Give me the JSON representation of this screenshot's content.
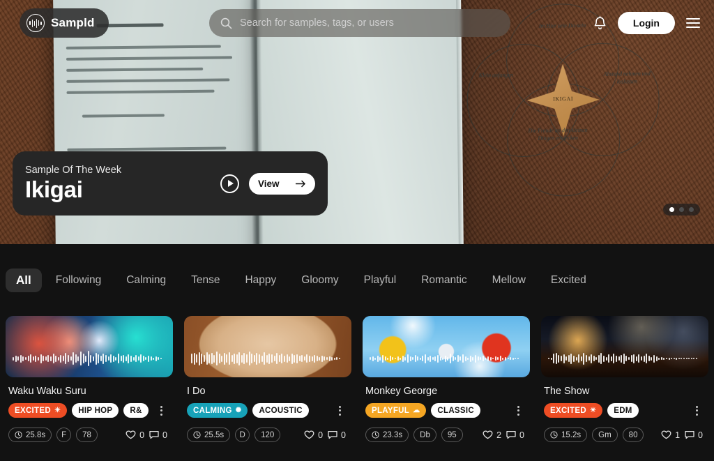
{
  "brand": {
    "name": "Sampld",
    "logo_icon": "waveform-circle-icon"
  },
  "search": {
    "placeholder": "Search for samples, tags, or users",
    "value": "",
    "icon": "search-icon"
  },
  "nav": {
    "bell_icon": "bell-icon",
    "login_label": "Login",
    "menu_icon": "hamburger-menu-icon"
  },
  "hero": {
    "eyebrow": "Sample Of The Week",
    "title": "Ikigai",
    "play_icon": "play-circle-icon",
    "view_label": "View",
    "arrow_icon": "arrow-right-icon",
    "carousel": {
      "total": 3,
      "active_index": 0
    },
    "book": {
      "venn_center": "IKIGAI",
      "venn_top": "Im Hier sein Da-sein",
      "venn_left": "Klein anfangen",
      "venn_right": "Abstand nehmen und loslassen",
      "venn_bottom": "Die Freude an den kleinen Dingen entdecken"
    }
  },
  "tabs": [
    {
      "label": "All",
      "active": true
    },
    {
      "label": "Following",
      "active": false
    },
    {
      "label": "Calming",
      "active": false
    },
    {
      "label": "Tense",
      "active": false
    },
    {
      "label": "Happy",
      "active": false
    },
    {
      "label": "Gloomy",
      "active": false
    },
    {
      "label": "Playful",
      "active": false
    },
    {
      "label": "Romantic",
      "active": false
    },
    {
      "label": "Mellow",
      "active": false
    },
    {
      "label": "Excited",
      "active": false
    }
  ],
  "colors": {
    "excited": "#ee4d24",
    "calming": "#17a2b8",
    "playful": "#f5a623",
    "light_tag": "#ffffff",
    "page_bg": "#121212"
  },
  "cards": [
    {
      "title": "Waku Waku Suru",
      "thumb": "neon-portrait-image",
      "mood": {
        "label": "EXCITED",
        "icon": "sun-icon",
        "color": "#ee4d24"
      },
      "tags": [
        "HIP HOP",
        "R&"
      ],
      "duration": "25.8s",
      "key": "F",
      "bpm": "78",
      "likes": "0",
      "comments": "0",
      "clock_icon": "clock-icon",
      "heart_icon": "heart-icon",
      "comment_icon": "comment-icon",
      "menu_icon": "kebab-menu-icon"
    },
    {
      "title": "I Do",
      "thumb": "wooden-box-i-do-image",
      "mood": {
        "label": "CALMING",
        "icon": "leaf-icon",
        "color": "#17a2b8"
      },
      "tags": [
        "ACOUSTIC"
      ],
      "duration": "25.5s",
      "key": "D",
      "bpm": "120",
      "likes": "0",
      "comments": "0",
      "clock_icon": "clock-icon",
      "heart_icon": "heart-icon",
      "comment_icon": "comment-icon",
      "menu_icon": "kebab-menu-icon"
    },
    {
      "title": "Monkey George",
      "thumb": "sky-monkeys-image",
      "mood": {
        "label": "PLAYFUL",
        "icon": "cloud-icon",
        "color": "#f5a623"
      },
      "tags": [
        "CLASSIC"
      ],
      "duration": "23.3s",
      "key": "Db",
      "bpm": "95",
      "likes": "2",
      "comments": "0",
      "clock_icon": "clock-icon",
      "heart_icon": "heart-icon",
      "comment_icon": "comment-icon",
      "menu_icon": "kebab-menu-icon"
    },
    {
      "title": "The Show",
      "thumb": "night-fire-dancer-image",
      "mood": {
        "label": "EXCITED",
        "icon": "sun-icon",
        "color": "#ee4d24"
      },
      "tags": [
        "EDM"
      ],
      "duration": "15.2s",
      "key": "Gm",
      "bpm": "80",
      "likes": "1",
      "comments": "0",
      "clock_icon": "clock-icon",
      "heart_icon": "heart-icon",
      "comment_icon": "comment-icon",
      "menu_icon": "kebab-menu-icon"
    }
  ]
}
